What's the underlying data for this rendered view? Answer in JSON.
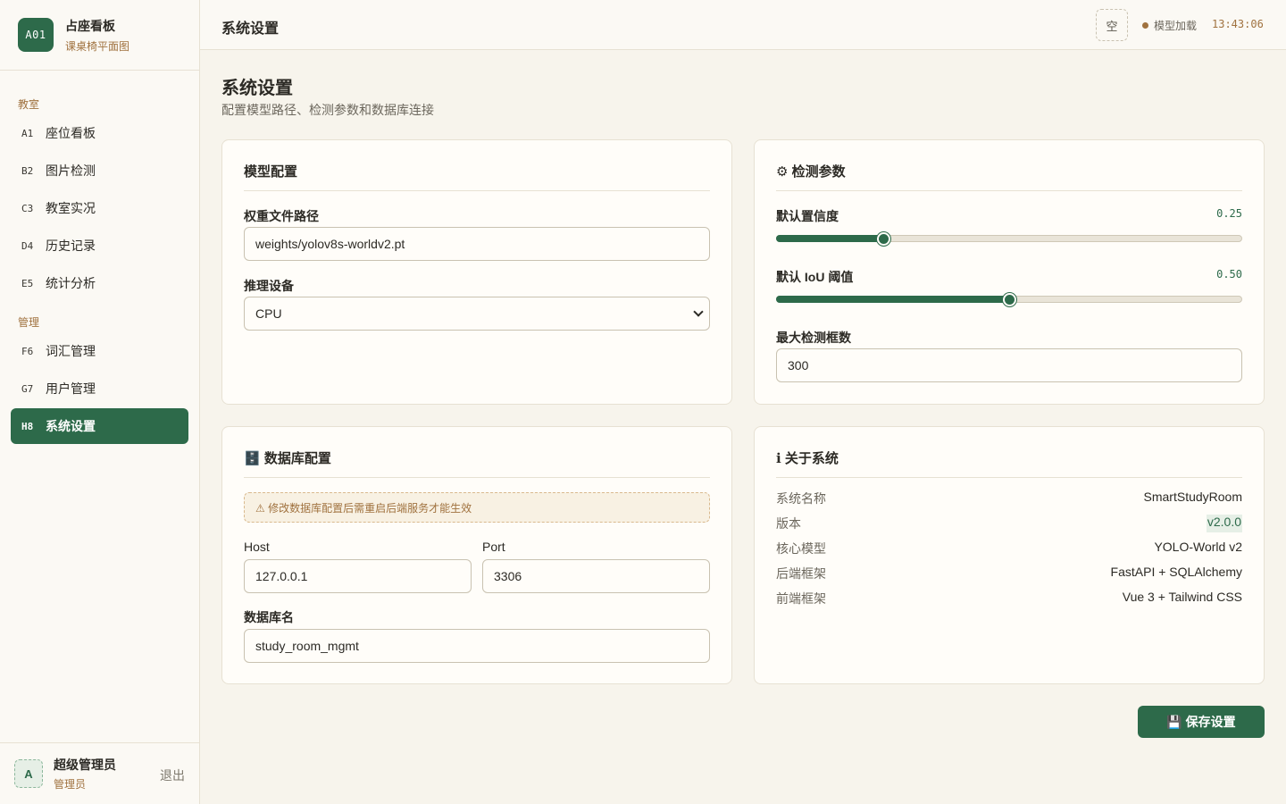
{
  "brand": {
    "logo": "A01",
    "title": "占座看板",
    "subtitle": "课桌椅平面图"
  },
  "sidebar": {
    "sections": [
      "教室",
      "管理"
    ],
    "items": [
      {
        "code": "A1",
        "label": "座位看板"
      },
      {
        "code": "B2",
        "label": "图片检测"
      },
      {
        "code": "C3",
        "label": "教室实况"
      },
      {
        "code": "D4",
        "label": "历史记录"
      },
      {
        "code": "E5",
        "label": "统计分析"
      },
      {
        "code": "F6",
        "label": "词汇管理"
      },
      {
        "code": "G7",
        "label": "用户管理"
      },
      {
        "code": "H8",
        "label": "系统设置"
      }
    ],
    "active": "H8"
  },
  "user": {
    "avatar": "A",
    "name": "超级管理员",
    "role": "管理员",
    "logout": "退出"
  },
  "header": {
    "title": "系统设置",
    "icon_button": "空",
    "status": "模型加载",
    "clock": "13:43:06"
  },
  "page": {
    "title": "系统设置",
    "subtitle": "配置模型路径、检测参数和数据库连接"
  },
  "model": {
    "title": "模型配置",
    "weights_label": "权重文件路径",
    "weights_value": "weights/yolov8s-worldv2.pt",
    "device_label": "推理设备",
    "device_value": "CPU"
  },
  "detect": {
    "title": "⚙ 检测参数",
    "conf_label": "默认置信度",
    "conf_value": "0.25",
    "conf_fraction": 0.23,
    "iou_label": "默认 IoU 阈值",
    "iou_value": "0.50",
    "iou_fraction": 0.5,
    "maxdet_label": "最大检测框数",
    "maxdet_value": "300"
  },
  "db": {
    "title": "🗄️ 数据库配置",
    "warning": "⚠ 修改数据库配置后需重启后端服务才能生效",
    "host_label": "Host",
    "host_value": "127.0.0.1",
    "port_label": "Port",
    "port_value": "3306",
    "name_label": "数据库名",
    "name_value": "study_room_mgmt"
  },
  "about": {
    "title": "ℹ 关于系统",
    "rows": [
      {
        "k": "系统名称",
        "v": "SmartStudyRoom"
      },
      {
        "k": "版本",
        "v": "v2.0.0"
      },
      {
        "k": "核心模型",
        "v": "YOLO-World v2"
      },
      {
        "k": "后端框架",
        "v": "FastAPI + SQLAlchemy"
      },
      {
        "k": "前端框架",
        "v": "Vue 3 + Tailwind CSS"
      }
    ]
  },
  "save_button": "💾 保存设置",
  "colors": {
    "accent": "#2d6a4a",
    "warm": "#a0723f",
    "background": "#f7f4ec"
  }
}
